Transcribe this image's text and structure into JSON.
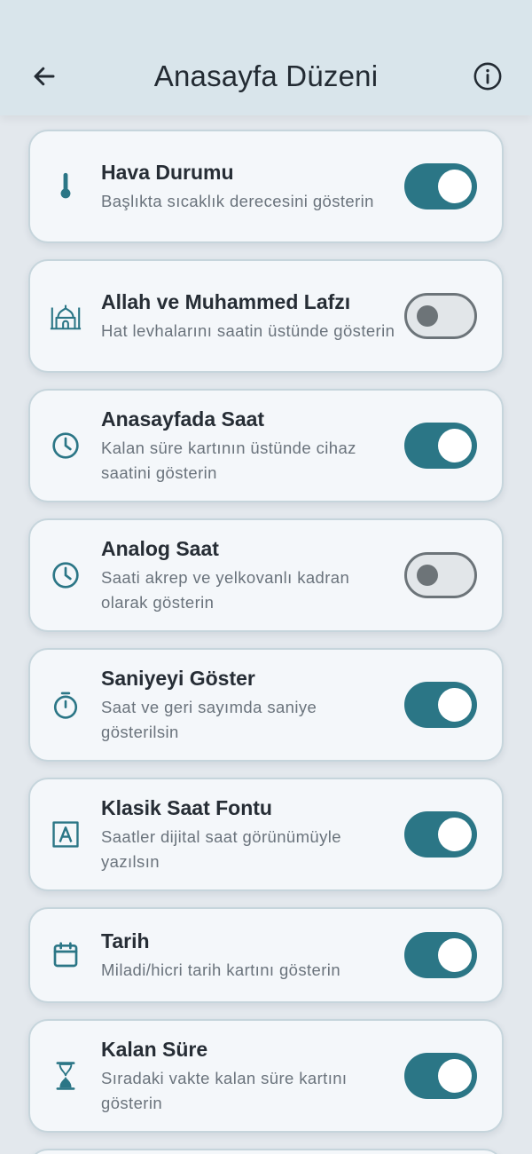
{
  "header": {
    "title": "Anasayfa Düzeni",
    "back_icon": "arrow-left-icon",
    "info_icon": "info-circle-icon"
  },
  "colors": {
    "accent": "#2b7686",
    "app_bar": "#d9e5eb",
    "background": "#e3e8ed",
    "card": "#f4f7fa",
    "card_border": "#c6d5dc"
  },
  "settings": [
    {
      "title": "Hava Durumu",
      "subtitle": "Başlıkta sıcaklık derecesini gösterin",
      "enabled": true,
      "icon": "thermometer-icon"
    },
    {
      "title": "Allah ve Muhammed Lafzı",
      "subtitle": "Hat levhalarını saatin üstünde gösterin",
      "enabled": false,
      "icon": "mosque-icon"
    },
    {
      "title": "Anasayfada Saat",
      "subtitle": "Kalan süre kartının üstünde cihaz saatini gösterin",
      "enabled": true,
      "icon": "clock-icon"
    },
    {
      "title": "Analog Saat",
      "subtitle": "Saati akrep ve yelkovanlı kadran olarak gösterin",
      "enabled": false,
      "icon": "clock-icon"
    },
    {
      "title": "Saniyeyi Göster",
      "subtitle": "Saat ve geri sayımda saniye gösterilsin",
      "enabled": true,
      "icon": "stopwatch-icon"
    },
    {
      "title": "Klasik Saat Fontu",
      "subtitle": "Saatler dijital saat görünümüyle yazılsın",
      "enabled": true,
      "icon": "font-box-icon"
    },
    {
      "title": "Tarih",
      "subtitle": "Miladi/hicri tarih kartını gösterin",
      "enabled": true,
      "icon": "calendar-icon"
    },
    {
      "title": "Kalan Süre",
      "subtitle": "Sıradaki vakte kalan süre kartını gösterin",
      "enabled": true,
      "icon": "hourglass-icon"
    }
  ]
}
